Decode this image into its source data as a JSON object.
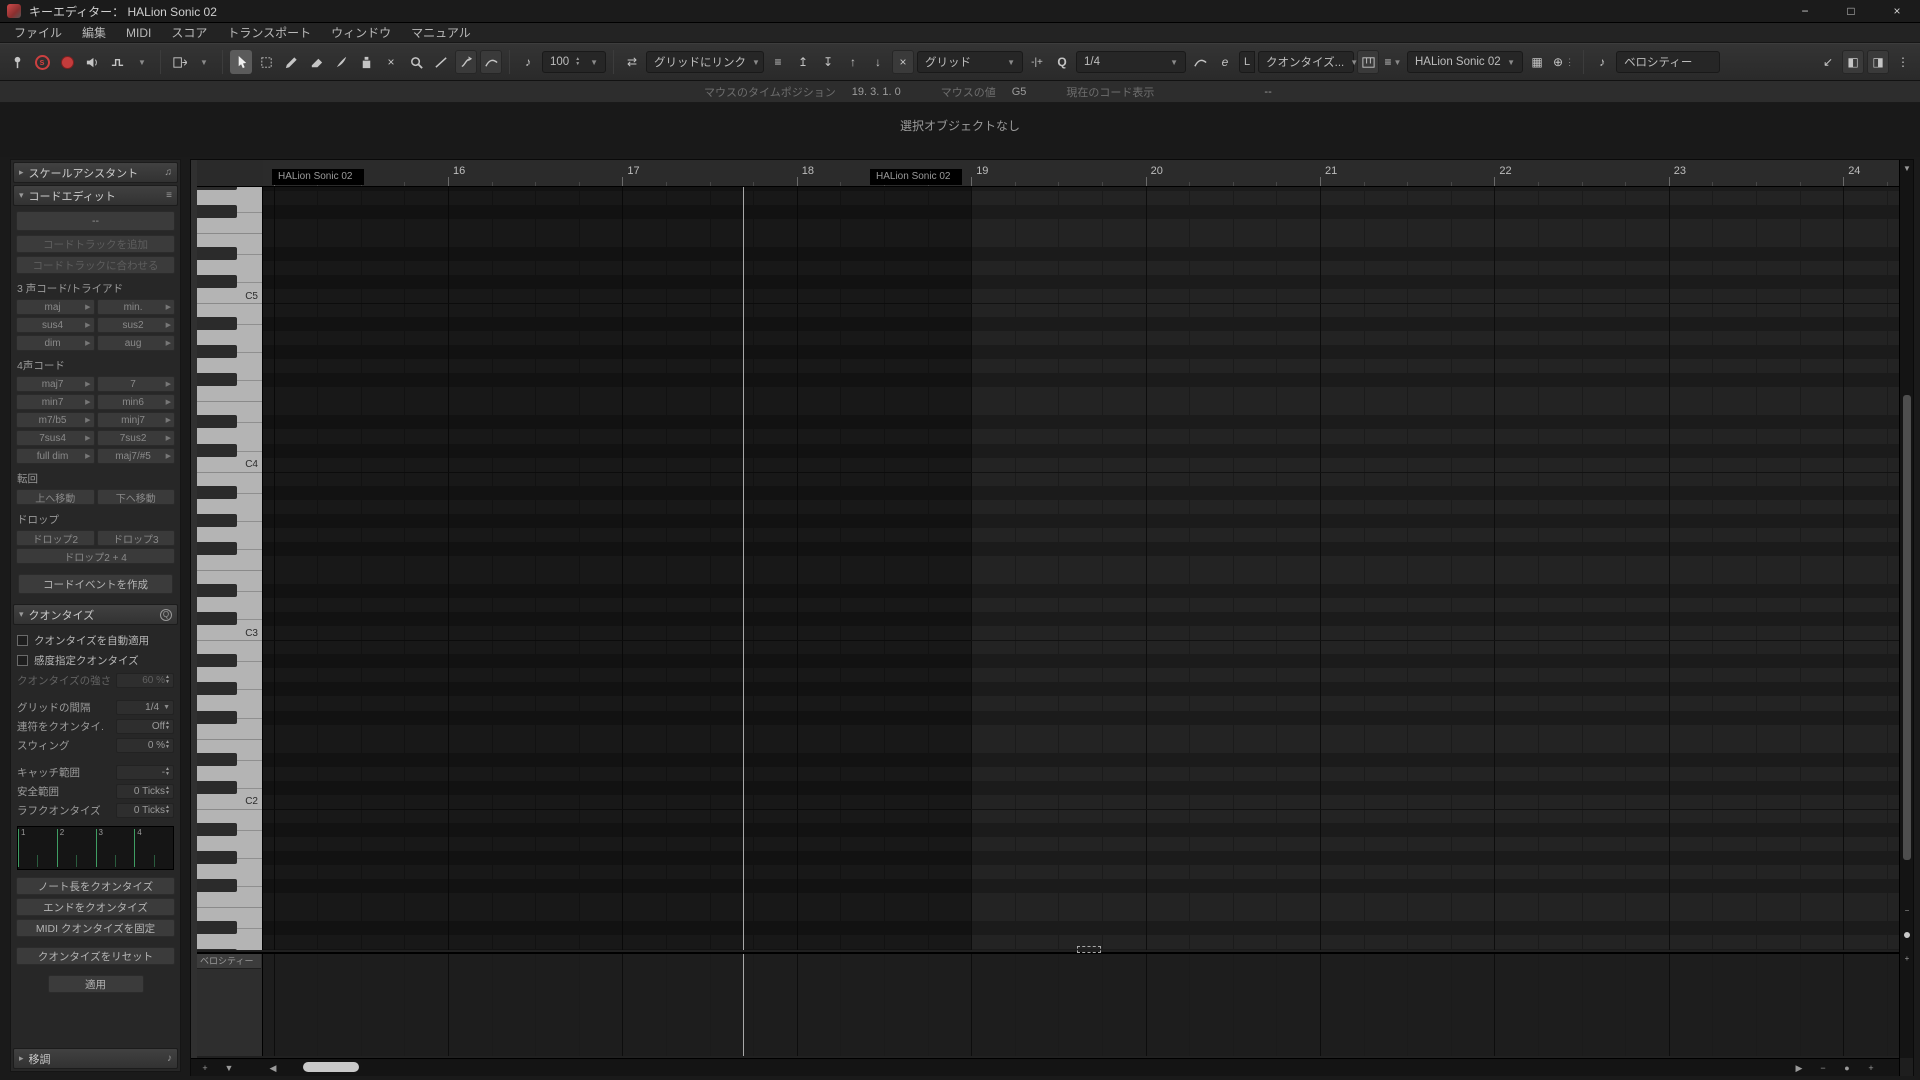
{
  "titlebar": {
    "title": "キーエディター： HALion Sonic 02"
  },
  "icons": {
    "chevron_down": "▼",
    "chevron_up": "▲",
    "chevron_right": "▶",
    "tri_collapsed": "▸",
    "tri_expanded": "▾",
    "minimize": "−",
    "maximize": "□",
    "close": "×",
    "menu_dots": "⋮",
    "corner_arrow": "↙",
    "pane_left": "◧",
    "pane_right": "◨",
    "link": "⇄",
    "nudge_up_bar": "↥",
    "nudge_down_bar": "↧",
    "arrow_up": "↑",
    "arrow_down": "↓",
    "grid4": "▦",
    "globe": "⊕",
    "note": "♪",
    "notes": "♫",
    "mute_x": "×",
    "minus": "−",
    "plus": "+",
    "dot": "●",
    "scroll_left": "◀",
    "scroll_right": "▶",
    "list": "≡",
    "split_pm": "-|+"
  },
  "menu": {
    "items": [
      "ファイル",
      "編集",
      "MIDI",
      "スコア",
      "トランスポート",
      "ウィンドウ",
      "マニュアル"
    ]
  },
  "toolbar": {
    "solo_letter": "s",
    "insert_velocity": "100",
    "grid_link": "グリッドにリンク",
    "grid_type": "グリッド",
    "q_letter": "Q",
    "quantize_preset": "1/4",
    "e_letter": "e",
    "l_letter": "L",
    "length_quantize": "クオンタイズ...",
    "part_name": "HALion Sonic 02",
    "event_colors": "ベロシティー"
  },
  "info_line": {
    "pos_label": "マウスのタイムポジション",
    "pos_value": "19. 3. 1. 0",
    "val_label": "マウスの値",
    "val_value": "G5",
    "chord_label": "現在のコード表示",
    "chord_value": "--"
  },
  "status": "選択オブジェクトなし",
  "inspector": {
    "scale_assistant": {
      "title": "スケールアシスタント"
    },
    "chord_edit": {
      "title": "コードエディット",
      "display": "--",
      "add_track": "コードトラックを追加",
      "follow_track": "コードトラックに合わせる",
      "triads_label": "3 声コード/トライアド",
      "triads": [
        "maj",
        "min.",
        "sus4",
        "sus2",
        "dim",
        "aug"
      ],
      "tetrads_label": "4声コード",
      "tetrads": [
        "maj7",
        "7",
        "min7",
        "min6",
        "m7/b5",
        "minj7",
        "7sus4",
        "7sus2",
        "full dim",
        "maj7/#5"
      ],
      "inversion_label": "転回",
      "move_up": "上へ移動",
      "move_down": "下へ移動",
      "drop_label": "ドロップ",
      "drop2": "ドロップ2",
      "drop3": "ドロップ3",
      "drop24": "ドロップ2 + 4",
      "create_event": "コードイベントを作成"
    },
    "quantize": {
      "title": "クオンタイズ",
      "auto_apply": "クオンタイズを自動適用",
      "iq": "感度指定クオンタイズ",
      "strength_label": "クオンタイズの強さ",
      "strength_value": "60 %",
      "rows": [
        {
          "label": "グリッドの間隔",
          "value": "1/4"
        },
        {
          "label": "連符をクオンタイ.",
          "value": "Off"
        },
        {
          "label": "スウィング",
          "value": "0 %"
        },
        {
          "label": "キャッチ範囲",
          "value": "-"
        },
        {
          "label": "安全範囲",
          "value": "0 Ticks"
        },
        {
          "label": "ラフクオンタイズ",
          "value": "0 Ticks"
        }
      ],
      "beats": [
        "1",
        "2",
        "3",
        "4"
      ],
      "btn_note_len": "ノート長をクオンタイズ",
      "btn_ends": "エンドをクオンタイズ",
      "btn_freeze": "MIDI クオンタイズを固定",
      "btn_reset": "クオンタイズをリセット",
      "btn_apply": "適用"
    },
    "transpose": {
      "title": "移調"
    }
  },
  "editor": {
    "measures": [
      "16",
      "17",
      "18",
      "19",
      "20",
      "21",
      "22",
      "23",
      "24"
    ],
    "part_chips": [
      "HALion Sonic 02",
      "HALion Sonic 02"
    ],
    "octave_labels": {
      "72": "C5",
      "60": "C4",
      "48": "C3",
      "36": "C2"
    },
    "velocity_label": "ベロシティー"
  }
}
